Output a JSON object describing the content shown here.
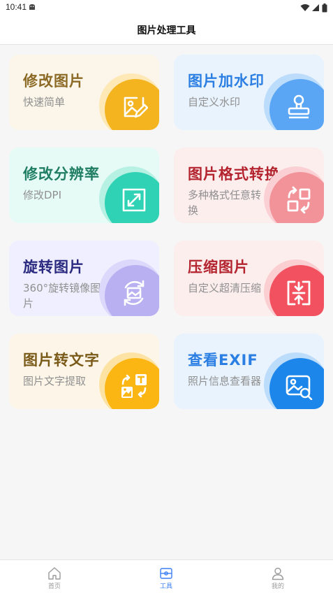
{
  "status_bar": {
    "time": "10:41"
  },
  "header": {
    "title": "图片处理工具"
  },
  "tools": [
    {
      "title": "修改图片",
      "subtitle": "快速简单",
      "icon": "edit-image-icon",
      "title_color": "#8c6a26",
      "bg": "#fbf6e9",
      "halo": "#fde8b6",
      "circle": "#f3b41f"
    },
    {
      "title": "图片加水印",
      "subtitle": "自定义水印",
      "icon": "stamp-icon",
      "title_color": "#2b7fe3",
      "bg": "#e9f3fd",
      "halo": "#bcdcfb",
      "circle": "#5aa6f5"
    },
    {
      "title": "修改分辨率",
      "subtitle": "修改DPI",
      "icon": "resize-icon",
      "title_color": "#1f7e63",
      "bg": "#e6fbf6",
      "halo": "#b6f1e3",
      "circle": "#2fd2b4"
    },
    {
      "title": "图片格式转换",
      "subtitle": "多种格式任意转换",
      "icon": "format-convert-icon",
      "title_color": "#b3242f",
      "bg": "#fdeeee",
      "halo": "#fbd0d4",
      "circle": "#f2939a"
    },
    {
      "title": "旋转图片",
      "subtitle": "360°旋转镜像图片",
      "icon": "rotate-image-icon",
      "title_color": "#2a2a80",
      "bg": "#f0efff",
      "halo": "#dcd8fb",
      "circle": "#b9b0f2"
    },
    {
      "title": "压缩图片",
      "subtitle": "自定义超清压缩",
      "icon": "compress-icon",
      "title_color": "#b3242f",
      "bg": "#fdeeee",
      "halo": "#fbcfd2",
      "circle": "#f2525f"
    },
    {
      "title": "图片转文字",
      "subtitle": "图片文字提取",
      "icon": "image-to-text-icon",
      "title_color": "#7a5a18",
      "bg": "#fdf6e8",
      "halo": "#fde3a3",
      "circle": "#fbb613"
    },
    {
      "title": "查看EXIF",
      "subtitle": "照片信息查看器",
      "icon": "exif-search-icon",
      "title_color": "#2b7fe3",
      "bg": "#e9f3fd",
      "halo": "#bcdcfb",
      "circle": "#1d86ea"
    }
  ],
  "nav": [
    {
      "label": "首页",
      "icon": "home-icon"
    },
    {
      "label": "工具",
      "icon": "tools-icon"
    },
    {
      "label": "我的",
      "icon": "profile-icon"
    }
  ]
}
